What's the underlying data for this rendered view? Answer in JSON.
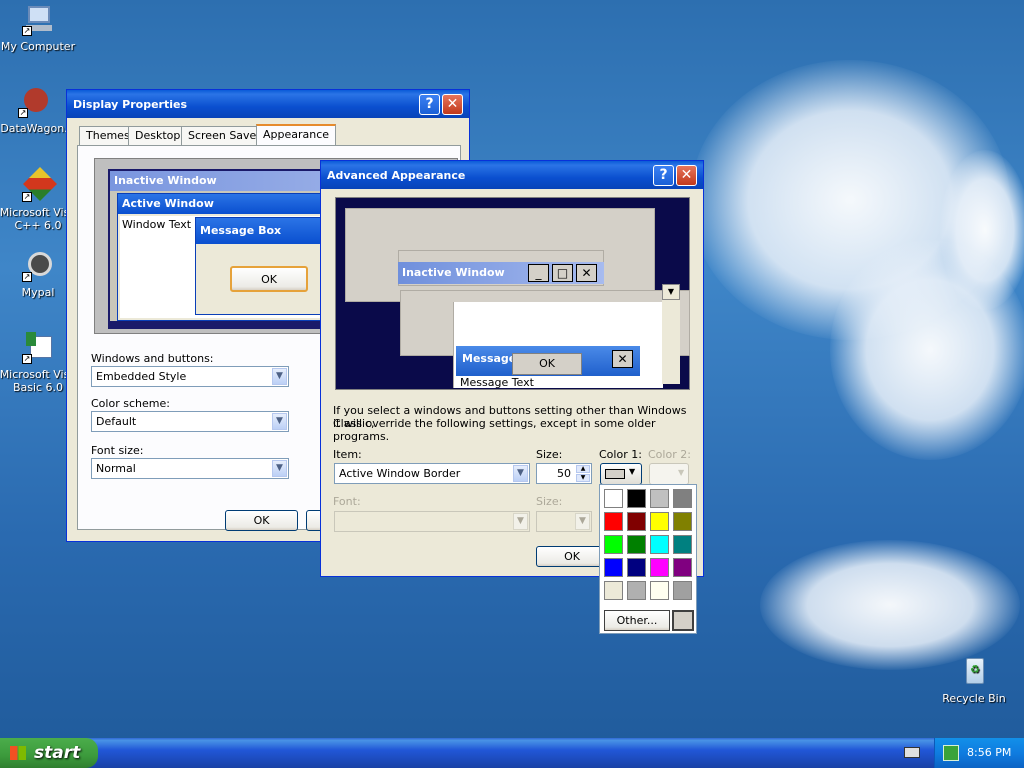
{
  "desktop": {
    "icons": [
      {
        "label": "My Computer"
      },
      {
        "label": "DataWagon."
      },
      {
        "label": "Microsoft Visu\nC++ 6.0"
      },
      {
        "label": "Mypal"
      },
      {
        "label": "Microsoft Visu\nBasic 6.0"
      },
      {
        "label": "Recycle Bin"
      }
    ]
  },
  "display_properties": {
    "title": "Display Properties",
    "tabs": [
      "Themes",
      "Desktop",
      "Screen Saver",
      "Appearance"
    ],
    "selected_tab": "Appearance",
    "preview": {
      "inactive_window": "Inactive Window",
      "active_window": "Active Window",
      "window_text": "Window Text",
      "message_box": "Message Box",
      "ok": "OK"
    },
    "windows_and_buttons_label": "Windows and buttons:",
    "windows_and_buttons_value": "Embedded Style",
    "color_scheme_label": "Color scheme:",
    "color_scheme_value": "Default",
    "font_size_label": "Font size:",
    "font_size_value": "Normal",
    "ok_button": "OK"
  },
  "advanced_appearance": {
    "title": "Advanced Appearance",
    "preview": {
      "inactive_window": "Inactive Window",
      "message_box": "Message B",
      "ok": "OK",
      "message_text": "Message Text"
    },
    "info_text_line1": "If you select a windows and buttons setting other than Windows Classic,",
    "info_text_line2": "it will override the following settings, except in some older programs.",
    "item_label": "Item:",
    "item_value": "Active Window Border",
    "size_label": "Size:",
    "size_value": "50",
    "color1_label": "Color 1:",
    "color2_label": "Color 2:",
    "font_label": "Font:",
    "font_size_label": "Size:",
    "ok_button": "OK"
  },
  "color_palette": {
    "colors": [
      "#ffffff",
      "#000000",
      "#c0c0c0",
      "#808080",
      "#ff0000",
      "#800000",
      "#ffff00",
      "#808000",
      "#00ff00",
      "#008000",
      "#00ffff",
      "#008080",
      "#0000ff",
      "#000080",
      "#ff00ff",
      "#800080",
      "#ece9d8",
      "#b0b0b0",
      "#fffff0",
      "#a0a0a0"
    ],
    "other_button": "Other..."
  },
  "taskbar": {
    "start_label": "start",
    "clock": "8:56 PM"
  },
  "colors": {
    "titlebar_blue": "#0a4fcf",
    "window_face": "#ece9d8",
    "preview_bg": "#0a0a4a"
  }
}
